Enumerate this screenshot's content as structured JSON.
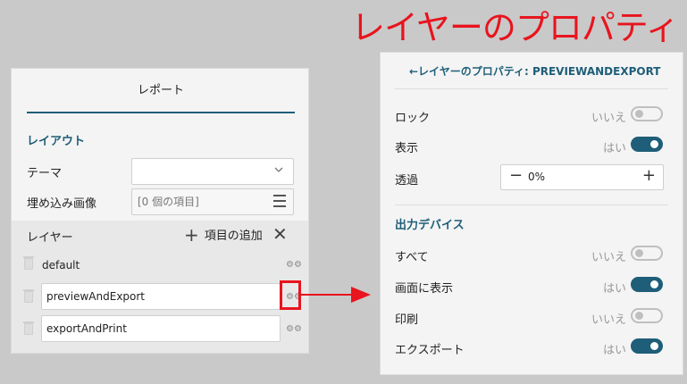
{
  "annotation_title": "レイヤーのプロパティ",
  "left_panel": {
    "header": "レポート",
    "section": "レイアウト",
    "theme_label": "テーマ",
    "theme_value": "",
    "embedded_label": "埋め込み画像",
    "embedded_value": "[0 個の項目]",
    "layers_label": "レイヤー",
    "add_item_label": "項目の追加",
    "layers": [
      {
        "name": "default"
      },
      {
        "name": "previewAndExport"
      },
      {
        "name": "exportAndPrint"
      }
    ]
  },
  "right_panel": {
    "title": "←レイヤーのプロパティ: PREVIEWANDEXPORT",
    "lock_label": "ロック",
    "lock_value": "いいえ",
    "visible_label": "表示",
    "visible_value": "はい",
    "opacity_label": "透過",
    "opacity_value": "0%",
    "output_section": "出力デバイス",
    "devices": [
      {
        "label": "すべて",
        "value": "いいえ",
        "on": false
      },
      {
        "label": "画面に表示",
        "value": "はい",
        "on": true
      },
      {
        "label": "印刷",
        "value": "いいえ",
        "on": false
      },
      {
        "label": "エクスポート",
        "value": "はい",
        "on": true
      }
    ]
  },
  "colors": {
    "accent": "#1e5e78",
    "annotation": "#e8141e"
  }
}
